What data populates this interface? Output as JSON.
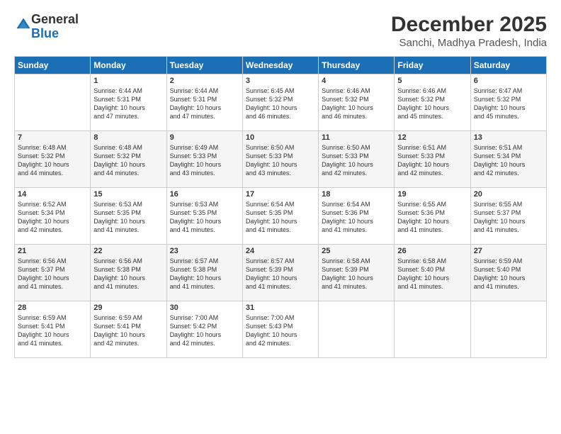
{
  "logo": {
    "general": "General",
    "blue": "Blue"
  },
  "header": {
    "title": "December 2025",
    "subtitle": "Sanchi, Madhya Pradesh, India"
  },
  "weekdays": [
    "Sunday",
    "Monday",
    "Tuesday",
    "Wednesday",
    "Thursday",
    "Friday",
    "Saturday"
  ],
  "weeks": [
    [
      {
        "day": "",
        "info": ""
      },
      {
        "day": "1",
        "info": "Sunrise: 6:44 AM\nSunset: 5:31 PM\nDaylight: 10 hours\nand 47 minutes."
      },
      {
        "day": "2",
        "info": "Sunrise: 6:44 AM\nSunset: 5:31 PM\nDaylight: 10 hours\nand 47 minutes."
      },
      {
        "day": "3",
        "info": "Sunrise: 6:45 AM\nSunset: 5:32 PM\nDaylight: 10 hours\nand 46 minutes."
      },
      {
        "day": "4",
        "info": "Sunrise: 6:46 AM\nSunset: 5:32 PM\nDaylight: 10 hours\nand 46 minutes."
      },
      {
        "day": "5",
        "info": "Sunrise: 6:46 AM\nSunset: 5:32 PM\nDaylight: 10 hours\nand 45 minutes."
      },
      {
        "day": "6",
        "info": "Sunrise: 6:47 AM\nSunset: 5:32 PM\nDaylight: 10 hours\nand 45 minutes."
      }
    ],
    [
      {
        "day": "7",
        "info": "Sunrise: 6:48 AM\nSunset: 5:32 PM\nDaylight: 10 hours\nand 44 minutes."
      },
      {
        "day": "8",
        "info": "Sunrise: 6:48 AM\nSunset: 5:32 PM\nDaylight: 10 hours\nand 44 minutes."
      },
      {
        "day": "9",
        "info": "Sunrise: 6:49 AM\nSunset: 5:33 PM\nDaylight: 10 hours\nand 43 minutes."
      },
      {
        "day": "10",
        "info": "Sunrise: 6:50 AM\nSunset: 5:33 PM\nDaylight: 10 hours\nand 43 minutes."
      },
      {
        "day": "11",
        "info": "Sunrise: 6:50 AM\nSunset: 5:33 PM\nDaylight: 10 hours\nand 42 minutes."
      },
      {
        "day": "12",
        "info": "Sunrise: 6:51 AM\nSunset: 5:33 PM\nDaylight: 10 hours\nand 42 minutes."
      },
      {
        "day": "13",
        "info": "Sunrise: 6:51 AM\nSunset: 5:34 PM\nDaylight: 10 hours\nand 42 minutes."
      }
    ],
    [
      {
        "day": "14",
        "info": "Sunrise: 6:52 AM\nSunset: 5:34 PM\nDaylight: 10 hours\nand 42 minutes."
      },
      {
        "day": "15",
        "info": "Sunrise: 6:53 AM\nSunset: 5:35 PM\nDaylight: 10 hours\nand 41 minutes."
      },
      {
        "day": "16",
        "info": "Sunrise: 6:53 AM\nSunset: 5:35 PM\nDaylight: 10 hours\nand 41 minutes."
      },
      {
        "day": "17",
        "info": "Sunrise: 6:54 AM\nSunset: 5:35 PM\nDaylight: 10 hours\nand 41 minutes."
      },
      {
        "day": "18",
        "info": "Sunrise: 6:54 AM\nSunset: 5:36 PM\nDaylight: 10 hours\nand 41 minutes."
      },
      {
        "day": "19",
        "info": "Sunrise: 6:55 AM\nSunset: 5:36 PM\nDaylight: 10 hours\nand 41 minutes."
      },
      {
        "day": "20",
        "info": "Sunrise: 6:55 AM\nSunset: 5:37 PM\nDaylight: 10 hours\nand 41 minutes."
      }
    ],
    [
      {
        "day": "21",
        "info": "Sunrise: 6:56 AM\nSunset: 5:37 PM\nDaylight: 10 hours\nand 41 minutes."
      },
      {
        "day": "22",
        "info": "Sunrise: 6:56 AM\nSunset: 5:38 PM\nDaylight: 10 hours\nand 41 minutes."
      },
      {
        "day": "23",
        "info": "Sunrise: 6:57 AM\nSunset: 5:38 PM\nDaylight: 10 hours\nand 41 minutes."
      },
      {
        "day": "24",
        "info": "Sunrise: 6:57 AM\nSunset: 5:39 PM\nDaylight: 10 hours\nand 41 minutes."
      },
      {
        "day": "25",
        "info": "Sunrise: 6:58 AM\nSunset: 5:39 PM\nDaylight: 10 hours\nand 41 minutes."
      },
      {
        "day": "26",
        "info": "Sunrise: 6:58 AM\nSunset: 5:40 PM\nDaylight: 10 hours\nand 41 minutes."
      },
      {
        "day": "27",
        "info": "Sunrise: 6:59 AM\nSunset: 5:40 PM\nDaylight: 10 hours\nand 41 minutes."
      }
    ],
    [
      {
        "day": "28",
        "info": "Sunrise: 6:59 AM\nSunset: 5:41 PM\nDaylight: 10 hours\nand 41 minutes."
      },
      {
        "day": "29",
        "info": "Sunrise: 6:59 AM\nSunset: 5:41 PM\nDaylight: 10 hours\nand 42 minutes."
      },
      {
        "day": "30",
        "info": "Sunrise: 7:00 AM\nSunset: 5:42 PM\nDaylight: 10 hours\nand 42 minutes."
      },
      {
        "day": "31",
        "info": "Sunrise: 7:00 AM\nSunset: 5:43 PM\nDaylight: 10 hours\nand 42 minutes."
      },
      {
        "day": "",
        "info": ""
      },
      {
        "day": "",
        "info": ""
      },
      {
        "day": "",
        "info": ""
      }
    ]
  ]
}
